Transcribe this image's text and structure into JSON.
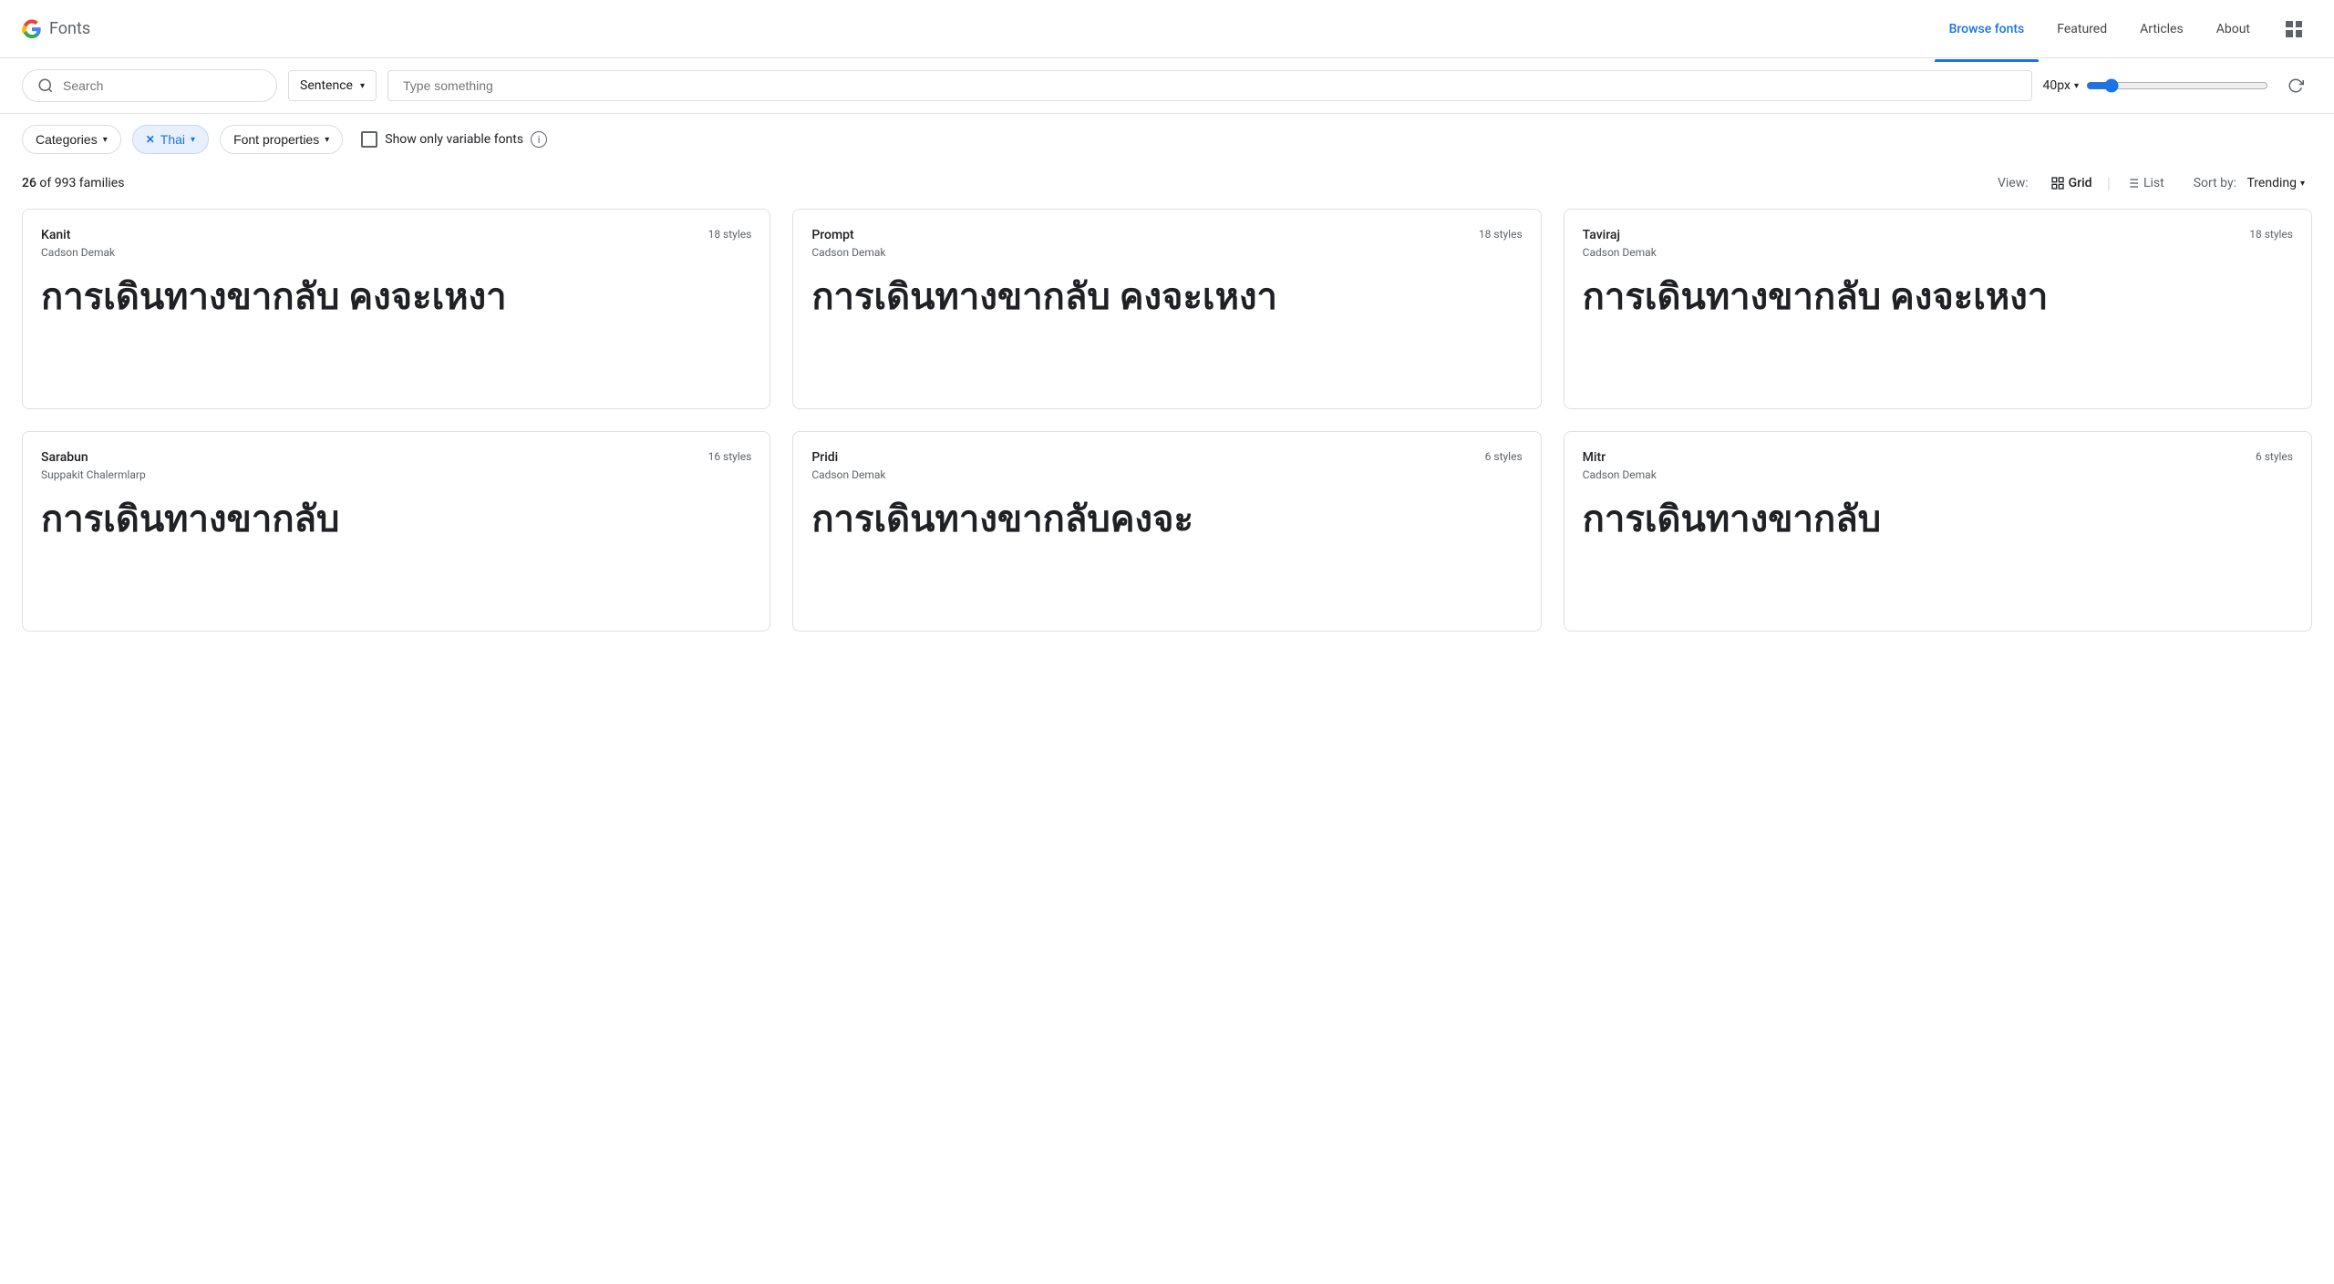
{
  "header": {
    "logo_google": "Google",
    "logo_fonts": "Fonts",
    "nav_items": [
      {
        "id": "browse",
        "label": "Browse fonts",
        "active": true
      },
      {
        "id": "featured",
        "label": "Featured",
        "active": false
      },
      {
        "id": "articles",
        "label": "Articles",
        "active": false
      },
      {
        "id": "about",
        "label": "About",
        "active": false
      }
    ]
  },
  "search_bar": {
    "search_placeholder": "Search",
    "sentence_label": "Sentence",
    "type_placeholder": "Type something",
    "size_value": "40px",
    "slider_value": 40,
    "slider_min": 8,
    "slider_max": 300
  },
  "filters": {
    "categories_label": "Categories",
    "thai_label": "Thai",
    "font_properties_label": "Font properties",
    "variable_fonts_label": "Show only variable fonts"
  },
  "toolbar": {
    "count": "26",
    "total": "993",
    "families_text": "of 993 families",
    "view_label": "View:",
    "grid_label": "Grid",
    "list_label": "List",
    "sort_label": "Sort by:",
    "sort_value": "Trending"
  },
  "fonts": [
    {
      "name": "Kanit",
      "author": "Cadson Demak",
      "styles": "18 styles",
      "preview": "การเดินทางขากลับ คงจะเหงา"
    },
    {
      "name": "Prompt",
      "author": "Cadson Demak",
      "styles": "18 styles",
      "preview": "การเดินทางขากลับ คงจะเหงา"
    },
    {
      "name": "Taviraj",
      "author": "Cadson Demak",
      "styles": "18 styles",
      "preview": "การเดินทางขากลับ คงจะเหงา"
    },
    {
      "name": "Sarabun",
      "author": "Suppakit Chalermlarp",
      "styles": "16 styles",
      "preview": "การเดินทางขากลับ"
    },
    {
      "name": "Pridi",
      "author": "Cadson Demak",
      "styles": "6 styles",
      "preview": "การเดินทางขากลับคงจะ"
    },
    {
      "name": "Mitr",
      "author": "Cadson Demak",
      "styles": "6 styles",
      "preview": "การเดินทางขากลับ"
    }
  ]
}
